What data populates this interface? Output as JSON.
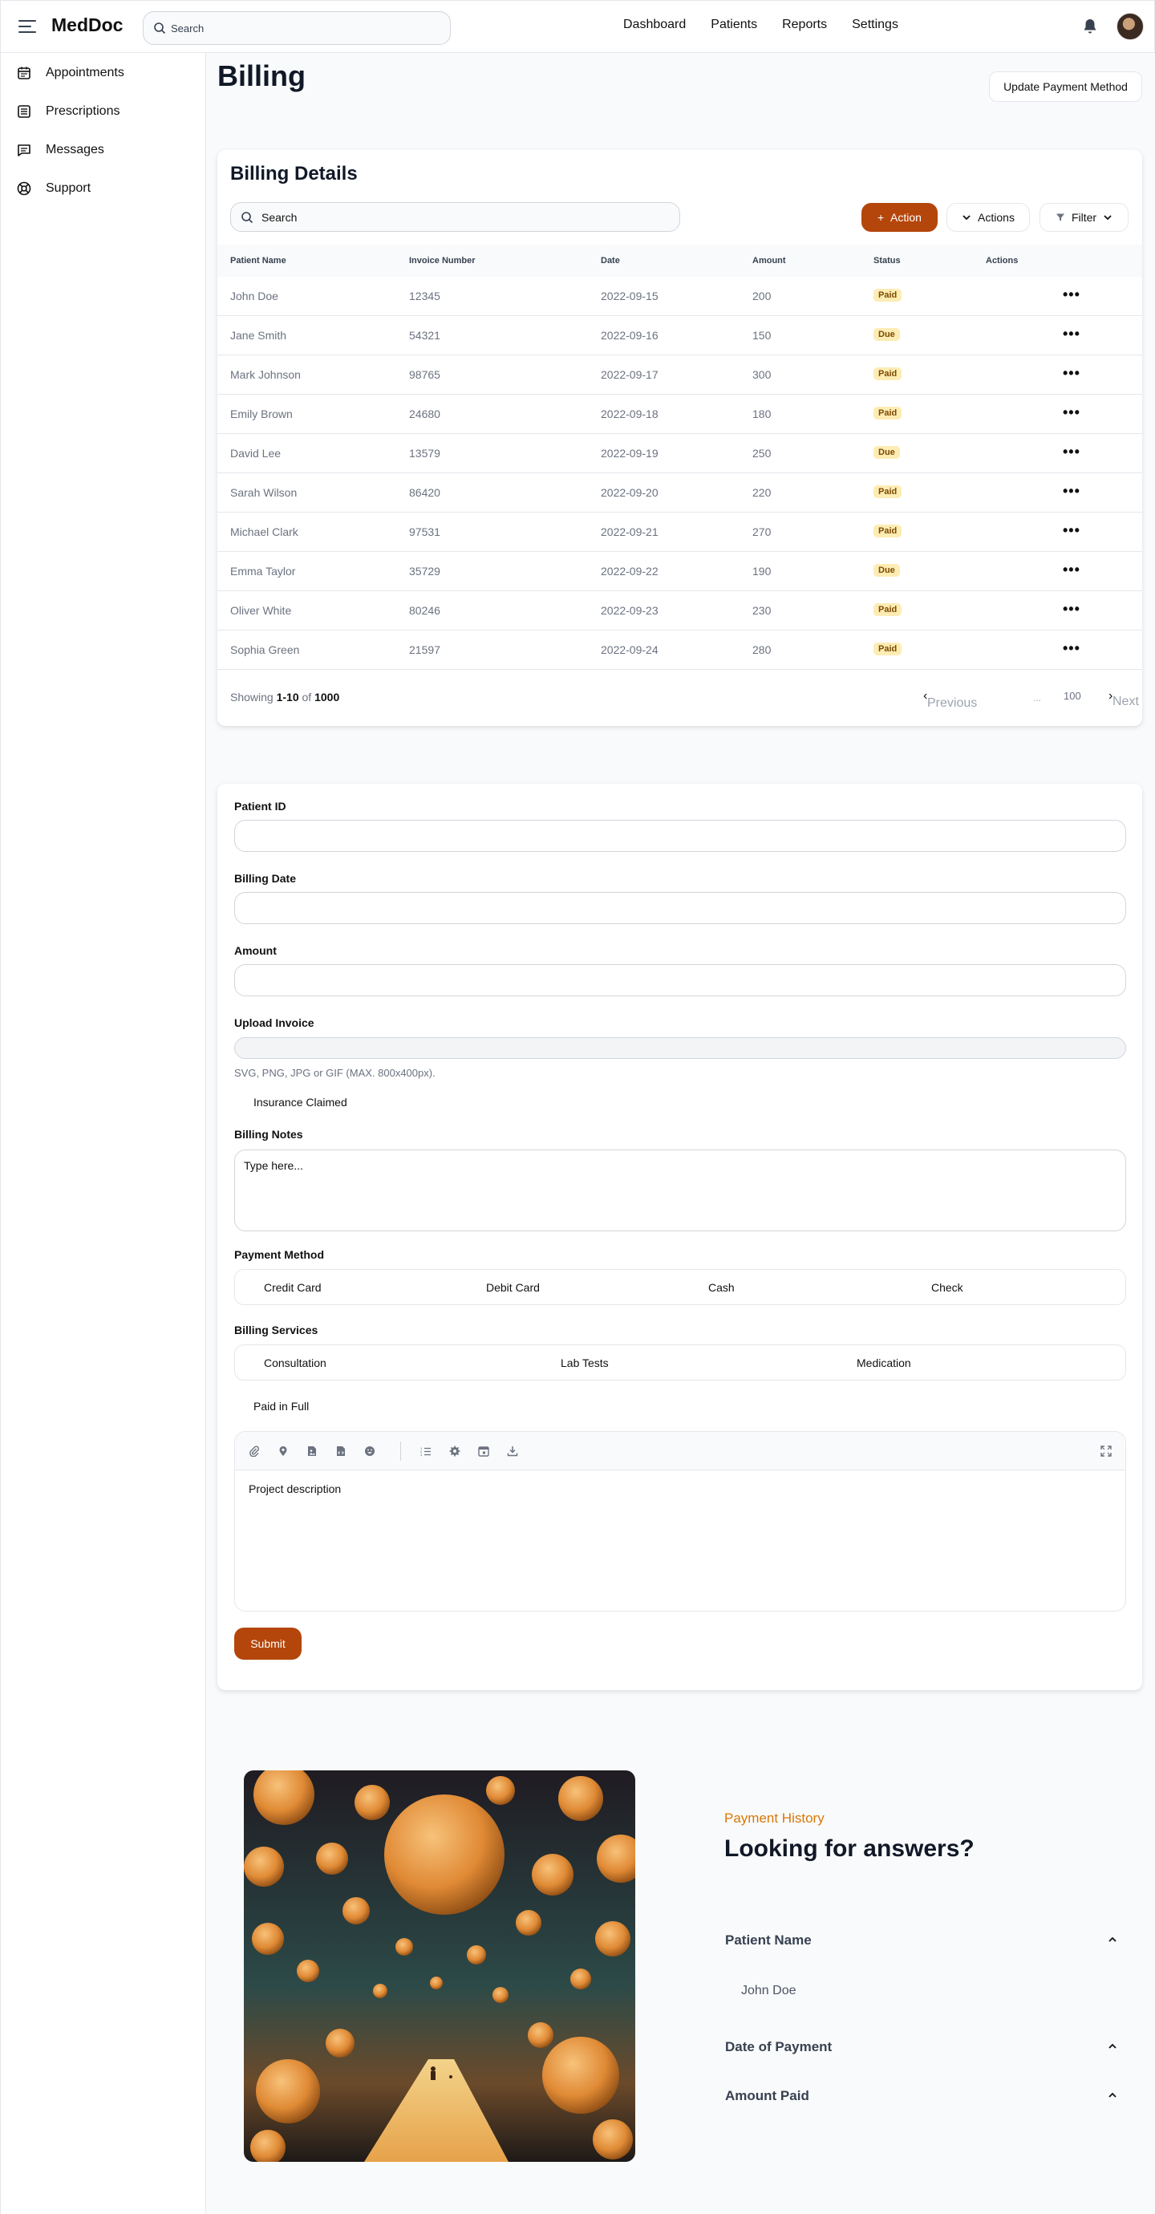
{
  "header": {
    "logo": "MedDoc",
    "search_placeholder": "Search",
    "nav": [
      "Dashboard",
      "Patients",
      "Reports",
      "Settings"
    ],
    "icons": [
      "menu-icon",
      "search-icon",
      "bell-icon",
      "avatar"
    ]
  },
  "sidebar": {
    "items": [
      {
        "label": "Appointments",
        "icon": "calendar-icon"
      },
      {
        "label": "Prescriptions",
        "icon": "list-icon"
      },
      {
        "label": "Messages",
        "icon": "chat-icon"
      },
      {
        "label": "Support",
        "icon": "lifebuoy-icon"
      }
    ]
  },
  "page": {
    "title": "Billing",
    "update_button": "Update Payment Method"
  },
  "billing": {
    "title": "Billing Details",
    "search_placeholder": "Search",
    "action_button": "Action",
    "actions_button": "Actions",
    "filter_button": "Filter",
    "columns": [
      "Patient Name",
      "Invoice Number",
      "Date",
      "Amount",
      "Status",
      "Actions"
    ],
    "rows": [
      {
        "name": "John Doe",
        "invoice": "12345",
        "date": "2022-09-15",
        "amount": "200",
        "status": "Paid"
      },
      {
        "name": "Jane Smith",
        "invoice": "54321",
        "date": "2022-09-16",
        "amount": "150",
        "status": "Due"
      },
      {
        "name": "Mark Johnson",
        "invoice": "98765",
        "date": "2022-09-17",
        "amount": "300",
        "status": "Paid"
      },
      {
        "name": "Emily Brown",
        "invoice": "24680",
        "date": "2022-09-18",
        "amount": "180",
        "status": "Paid"
      },
      {
        "name": "David Lee",
        "invoice": "13579",
        "date": "2022-09-19",
        "amount": "250",
        "status": "Due"
      },
      {
        "name": "Sarah Wilson",
        "invoice": "86420",
        "date": "2022-09-20",
        "amount": "220",
        "status": "Paid"
      },
      {
        "name": "Michael Clark",
        "invoice": "97531",
        "date": "2022-09-21",
        "amount": "270",
        "status": "Paid"
      },
      {
        "name": "Emma Taylor",
        "invoice": "35729",
        "date": "2022-09-22",
        "amount": "190",
        "status": "Due"
      },
      {
        "name": "Oliver White",
        "invoice": "80246",
        "date": "2022-09-23",
        "amount": "230",
        "status": "Paid"
      },
      {
        "name": "Sophia Green",
        "invoice": "21597",
        "date": "2022-09-24",
        "amount": "280",
        "status": "Paid"
      }
    ],
    "footer": {
      "showing": "Showing",
      "range": "1-10",
      "of": "of",
      "total": "1000"
    },
    "pagination": {
      "previous": "Previous",
      "ellipsis": "...",
      "last_page": "100",
      "next": "Next"
    }
  },
  "form": {
    "patient_id_label": "Patient ID",
    "billing_date_label": "Billing Date",
    "amount_label": "Amount",
    "upload_label": "Upload Invoice",
    "upload_hint": "SVG, PNG, JPG or GIF (MAX. 800x400px).",
    "insurance_label": "Insurance Claimed",
    "notes_label": "Billing Notes",
    "notes_placeholder": "Type here...",
    "payment_method_label": "Payment Method",
    "payment_methods": [
      "Credit Card",
      "Debit Card",
      "Cash",
      "Check"
    ],
    "services_label": "Billing Services",
    "services": [
      "Consultation",
      "Lab Tests",
      "Medication"
    ],
    "paid_full_label": "Paid in Full",
    "editor_toolbar": [
      "paperclip-icon",
      "map-pin-icon",
      "image-icon",
      "code-file-icon",
      "emoji-icon",
      "ordered-list-icon",
      "settings-icon",
      "calendar-icon",
      "download-icon",
      "fullscreen-icon"
    ],
    "editor_placeholder": "Project description",
    "submit": "Submit"
  },
  "faq": {
    "eyebrow": "Payment History",
    "title": "Looking for answers?",
    "items": [
      {
        "question": "Patient Name",
        "answer": "John Doe"
      },
      {
        "question": "Date of Payment"
      },
      {
        "question": "Amount Paid"
      }
    ]
  },
  "colors": {
    "accent": "#b4460b",
    "eyebrow": "#d97706",
    "badge_bg": "#fdecb3"
  }
}
